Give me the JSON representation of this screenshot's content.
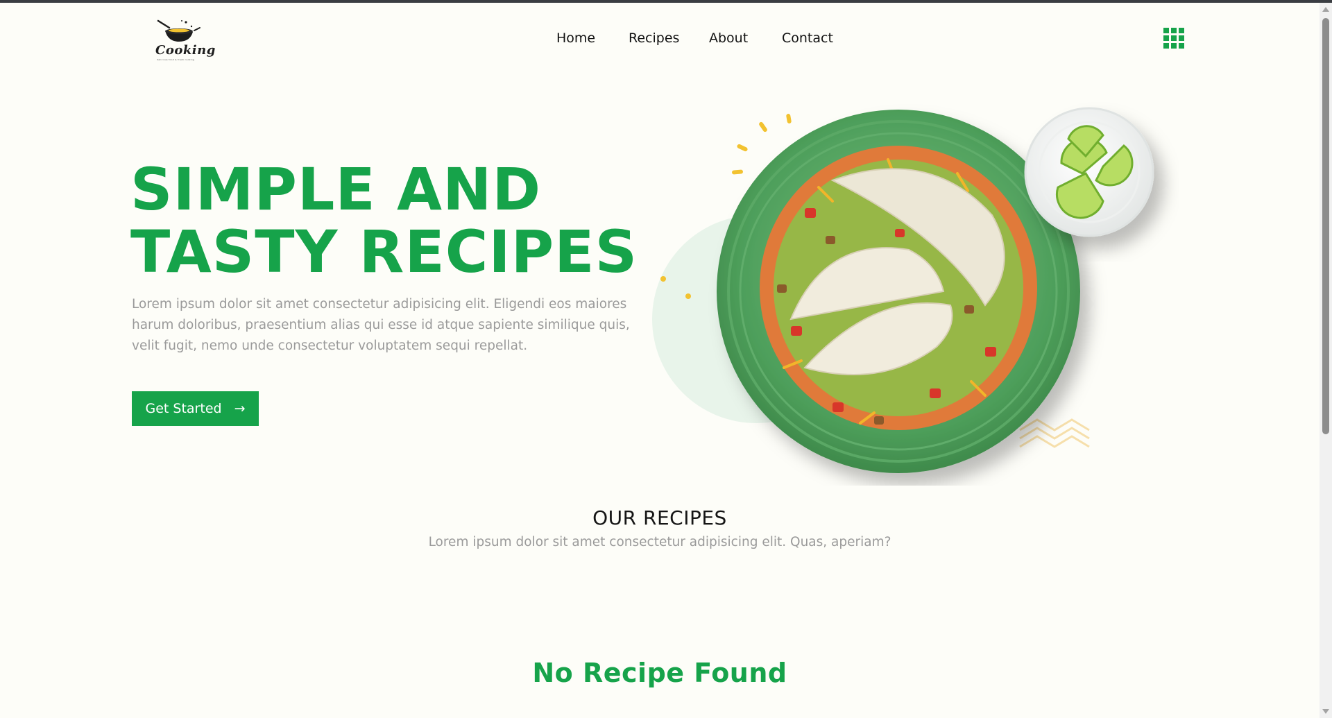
{
  "brand": {
    "name": "Cooking",
    "tagline": "delicious food & fresh cooking"
  },
  "nav": {
    "items": [
      "Home",
      "Recipes",
      "About",
      "Contact"
    ]
  },
  "hero": {
    "title_line1": "SIMPLE AND",
    "title_line2": "TASTY RECIPES",
    "description": "Lorem ipsum dolor sit amet consectetur adipisicing elit. Eligendi eos maiores harum doloribus, praesentium alias qui esse id atque sapiente similique quis, velit fugit, nemo unde consectetur voluptatem sequi repellat.",
    "cta_label": "Get Started",
    "cta_arrow": "→"
  },
  "recipes": {
    "title": "OUR RECIPES",
    "subtitle": "Lorem ipsum dolor sit amet consectetur adipisicing elit. Quas, aperiam?",
    "empty_message": "No Recipe Found"
  },
  "colors": {
    "accent": "#16a34a",
    "background": "#fdfdf8",
    "muted_text": "#9a9a9a"
  },
  "icons": {
    "menu": "grid-menu-icon",
    "logo": "cooking-pot-icon"
  }
}
